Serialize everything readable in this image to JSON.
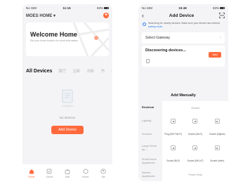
{
  "left": {
    "status": {
      "carrier": "No SIM",
      "time": "11:16",
      "battery": "83%"
    },
    "home_name": "MOES HOME",
    "welcome_title": "Welcome Home",
    "welcome_sub": "Set your home location for more information",
    "tabs": [
      "All Devices",
      "客厅",
      "主卧",
      "次卧",
      "书"
    ],
    "empty_text": "No devices",
    "add_button": "Add Device",
    "nav": [
      "Home",
      "Scene",
      "Mall",
      "Smart",
      "Me"
    ],
    "accent": "#ff6a3d"
  },
  "right": {
    "status": {
      "carrier": "No SIM",
      "time": "15:48",
      "battery": "83%"
    },
    "title": "Add Device",
    "search_text": "Searching for nearby devices. Make sure your device has entered",
    "search_link": "pairing mode.",
    "gateway_label": "Select Gateway",
    "discover_label": "Discovering devices...",
    "add_small": "Add",
    "manual_title": "Add Manually",
    "categories": [
      "Electrical",
      "Lighting",
      "Sensors",
      "Large Home Ap...",
      "Small Home Appliances",
      "Kitchen Appliances"
    ],
    "rows": [
      {
        "section": "Socket"
      },
      {
        "devices": [
          "",
          "",
          ""
        ]
      },
      {
        "devices": [
          "Plug (BLE+Wi-Fi)",
          "Socket (Wi-Fi)",
          "Socket (Zigbee)"
        ]
      },
      {
        "devices": [
          "",
          "",
          ""
        ]
      },
      {
        "devices": [
          "Socket (BLE)",
          "Socket (NB-IoT)",
          "Socket (other)"
        ]
      },
      {
        "section": "Power Strip"
      }
    ]
  }
}
